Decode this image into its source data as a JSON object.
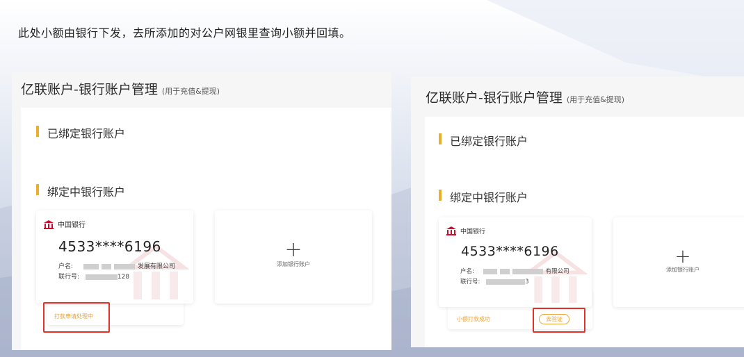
{
  "instruction": "此处小额由银行下发，去所添加的对公户网银里查询小额并回填。",
  "colors": {
    "accent": "#e9b12b",
    "status": "#e9a23b",
    "highlight": "#e2312a",
    "bank_red": "#c8102e"
  },
  "panels": [
    {
      "title": "亿联账户-银行账户管理",
      "subtitle": "(用于充值&提现)",
      "section_bound": "已绑定银行账户",
      "section_bind": "绑定中银行账户",
      "card": {
        "bank_name": "中国银行",
        "bank_icon": "bank-building-icon",
        "card_number": "4533****6196",
        "account_name_label": "户名:",
        "account_name_value": "发展有限公司",
        "bank_code_label": "联行号:",
        "bank_code_value": "128"
      },
      "status_text": "打款申请处理中",
      "add_label": "添加银行账户",
      "add_icon": "plus-icon"
    },
    {
      "title": "亿联账户-银行账户管理",
      "subtitle": "(用于充值&提现)",
      "section_bound": "已绑定银行账户",
      "section_bind": "绑定中银行账户",
      "card": {
        "bank_name": "中国银行",
        "bank_icon": "bank-building-icon",
        "card_number": "4533****6196",
        "account_name_label": "户名:",
        "account_name_value": "有限公司",
        "bank_code_label": "联行号:",
        "bank_code_value": "3"
      },
      "status_text": "小额打款成功",
      "verify_label": "去验证",
      "add_label": "添加银行账户",
      "add_icon": "plus-icon"
    }
  ]
}
